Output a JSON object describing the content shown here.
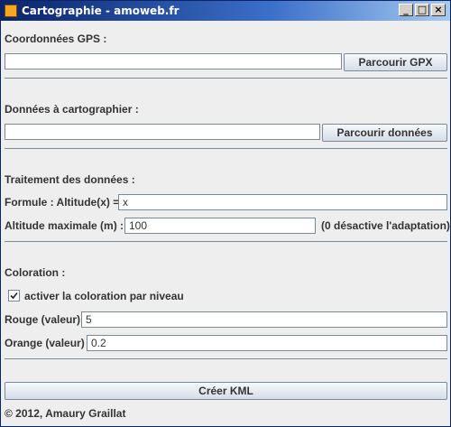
{
  "window": {
    "title": "Cartographie - amoweb.fr"
  },
  "gps": {
    "heading": "Coordonnées GPS :",
    "path_value": "",
    "browse_label": "Parcourir GPX"
  },
  "data": {
    "heading": "Données à cartographier :",
    "path_value": "",
    "browse_label": "Parcourir données"
  },
  "processing": {
    "heading": "Traitement des données :",
    "formula_label": "Formule : Altitude(x) =",
    "formula_value": "x",
    "max_altitude_label": "Altitude maximale (m) :",
    "max_altitude_value": "100",
    "max_altitude_hint": "(0 désactive l'adaptation)"
  },
  "coloration": {
    "heading": "Coloration :",
    "checkbox_label": "activer la coloration par niveau",
    "checkbox_checked": true,
    "red_label": "Rouge (valeur)",
    "red_value": "5",
    "orange_label": "Orange (valeur)",
    "orange_value": "0.2"
  },
  "create_label": "Créer KML",
  "footer": "© 2012, Amaury Graillat"
}
